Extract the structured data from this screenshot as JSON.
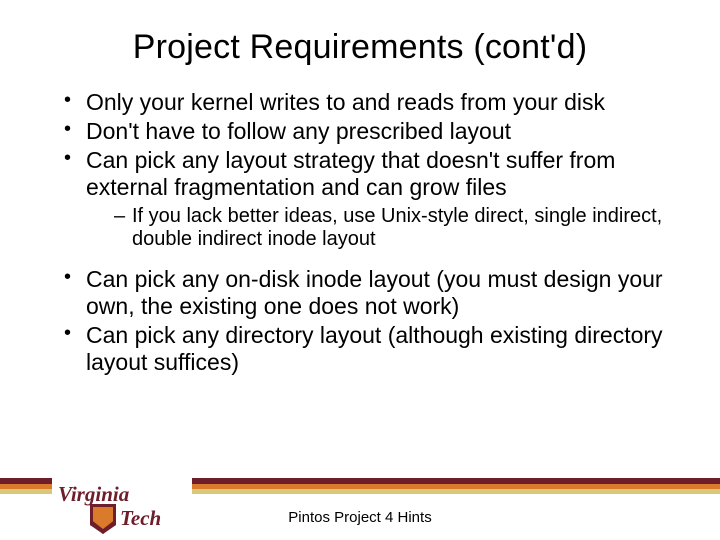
{
  "title": "Project Requirements (cont'd)",
  "bullets": {
    "b1": "Only your kernel writes to and reads from your disk",
    "b2": "Don't have to follow any prescribed layout",
    "b3": "Can pick any layout strategy that doesn't suffer from external fragmentation and can grow files",
    "b3_sub1": "If you lack better ideas, use Unix-style direct, single indirect, double indirect inode layout",
    "b4": "Can pick any on-disk inode layout (you must design your own, the existing one does not work)",
    "b5": "Can pick any directory layout (although existing directory layout suffices)"
  },
  "footer_text": "Pintos Project 4 Hints",
  "logo": {
    "word1": "Virginia",
    "word2": "Tech"
  }
}
